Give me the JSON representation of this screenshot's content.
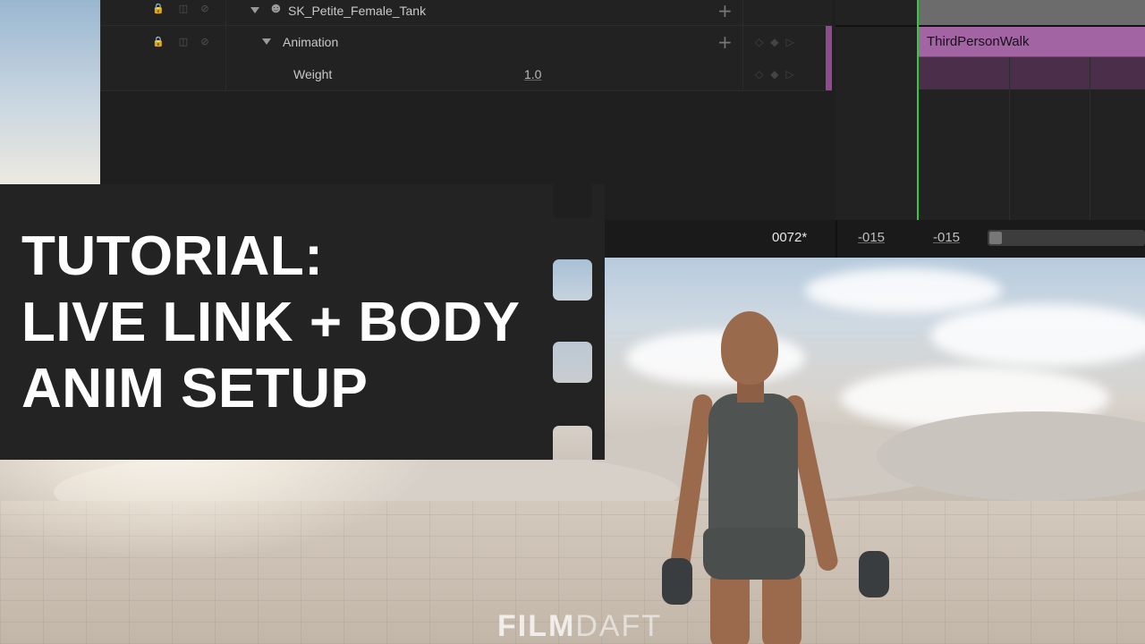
{
  "sequencer": {
    "rows": [
      {
        "label": "SK_Petite_Female_Tank",
        "icon": "skeleton-icon",
        "has_plus": true
      },
      {
        "label": "Animation",
        "has_plus": true,
        "keys": "◇◆▷"
      },
      {
        "label": "Weight",
        "value": "1.0",
        "keys": "◇◆▷"
      }
    ],
    "clip_label": "ThirdPersonWalk",
    "current_frame": "0072*",
    "range_start": "-015",
    "range_end": "-015",
    "colors": {
      "clip": "#a264a2",
      "playhead": "#2ecc40",
      "panel": "#1f1f1f"
    }
  },
  "title_card": {
    "lines": [
      "TUTORIAL:",
      "LIVE LINK + BODY",
      "ANIM SETUP"
    ]
  },
  "watermark": {
    "part1": "FILM",
    "part2": "DAFT"
  }
}
